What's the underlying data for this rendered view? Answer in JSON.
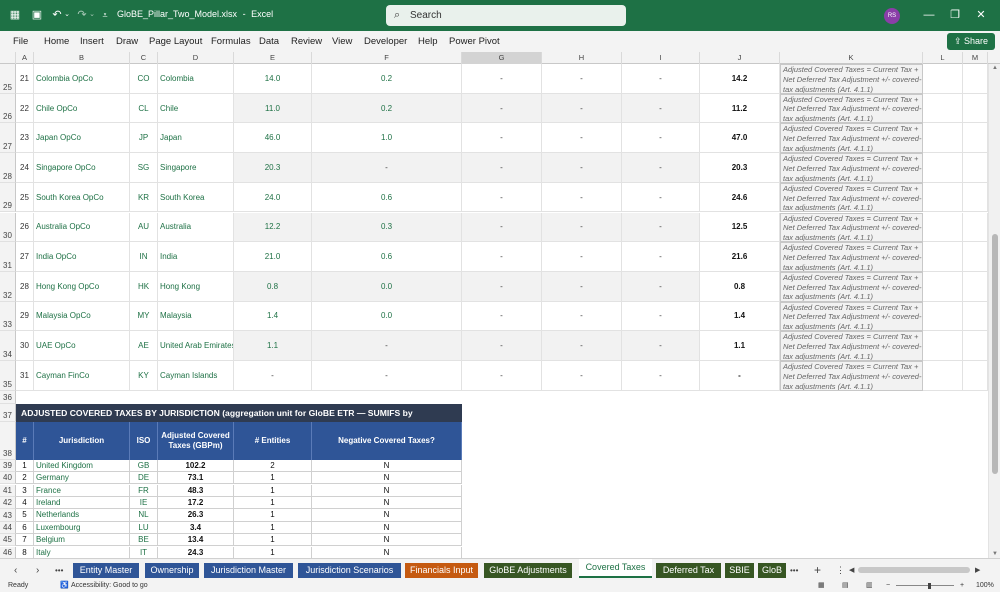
{
  "titlebar": {
    "filename": "GloBE_Pillar_Two_Model.xlsx",
    "separator": "-",
    "app": "Excel",
    "search_placeholder": "Search",
    "avatar_initials": "RS"
  },
  "menu": [
    "File",
    "Home",
    "Insert",
    "Draw",
    "Page Layout",
    "Formulas",
    "Data",
    "Review",
    "View",
    "Developer",
    "Help",
    "Power Pivot"
  ],
  "share_label": "Share",
  "columns": [
    "A",
    "B",
    "C",
    "D",
    "E",
    "F",
    "G",
    "H",
    "I",
    "J",
    "K",
    "L",
    "M"
  ],
  "entity_rows": [
    {
      "row": "25",
      "a": "21",
      "name": "Colombia OpCo",
      "iso": "CO",
      "country": "Colombia",
      "e": "14.0",
      "f": "0.2",
      "g": "-",
      "h": "-",
      "i": "-",
      "j": "14.2"
    },
    {
      "row": "26",
      "a": "22",
      "name": "Chile OpCo",
      "iso": "CL",
      "country": "Chile",
      "e": "11.0",
      "f": "0.2",
      "g": "-",
      "h": "-",
      "i": "-",
      "j": "11.2"
    },
    {
      "row": "27",
      "a": "23",
      "name": "Japan OpCo",
      "iso": "JP",
      "country": "Japan",
      "e": "46.0",
      "f": "1.0",
      "g": "-",
      "h": "-",
      "i": "-",
      "j": "47.0"
    },
    {
      "row": "28",
      "a": "24",
      "name": "Singapore OpCo",
      "iso": "SG",
      "country": "Singapore",
      "e": "20.3",
      "f": "-",
      "g": "-",
      "h": "-",
      "i": "-",
      "j": "20.3"
    },
    {
      "row": "29",
      "a": "25",
      "name": "South Korea OpCo",
      "iso": "KR",
      "country": "South Korea",
      "e": "24.0",
      "f": "0.6",
      "g": "-",
      "h": "-",
      "i": "-",
      "j": "24.6"
    },
    {
      "row": "30",
      "a": "26",
      "name": "Australia OpCo",
      "iso": "AU",
      "country": "Australia",
      "e": "12.2",
      "f": "0.3",
      "g": "-",
      "h": "-",
      "i": "-",
      "j": "12.5"
    },
    {
      "row": "31",
      "a": "27",
      "name": "India OpCo",
      "iso": "IN",
      "country": "India",
      "e": "21.0",
      "f": "0.6",
      "g": "-",
      "h": "-",
      "i": "-",
      "j": "21.6"
    },
    {
      "row": "32",
      "a": "28",
      "name": "Hong Kong OpCo",
      "iso": "HK",
      "country": "Hong Kong",
      "e": "0.8",
      "f": "0.0",
      "g": "-",
      "h": "-",
      "i": "-",
      "j": "0.8"
    },
    {
      "row": "33",
      "a": "29",
      "name": "Malaysia OpCo",
      "iso": "MY",
      "country": "Malaysia",
      "e": "1.4",
      "f": "0.0",
      "g": "-",
      "h": "-",
      "i": "-",
      "j": "1.4"
    },
    {
      "row": "34",
      "a": "30",
      "name": "UAE OpCo",
      "iso": "AE",
      "country": "United Arab Emirates",
      "e": "1.1",
      "f": "-",
      "g": "-",
      "h": "-",
      "i": "-",
      "j": "1.1"
    },
    {
      "row": "35",
      "a": "31",
      "name": "Cayman FinCo",
      "iso": "KY",
      "country": "Cayman Islands",
      "e": "-",
      "f": "-",
      "g": "-",
      "h": "-",
      "i": "-",
      "j": "-"
    }
  ],
  "note_text": "Adjusted Covered Taxes = Current Tax + Net Deferred Tax Adjustment +/- covered-tax adjustments (Art. 4.1.1)",
  "blank_row": "36",
  "summary": {
    "banner_row": "37",
    "banner": "ADJUSTED COVERED TAXES BY JURISDICTION  (aggregation unit for GloBE ETR — SUMIFS by",
    "header_row": "38",
    "headers": [
      "#",
      "Jurisdiction",
      "ISO",
      "Adjusted Covered Taxes (GBPm)",
      "# Entities",
      "Negative Covered Taxes?"
    ],
    "rows": [
      {
        "row": "39",
        "n": "1",
        "j": "United Kingdom",
        "iso": "GB",
        "tax": "102.2",
        "ent": "2",
        "neg": "N"
      },
      {
        "row": "40",
        "n": "2",
        "j": "Germany",
        "iso": "DE",
        "tax": "73.1",
        "ent": "1",
        "neg": "N"
      },
      {
        "row": "41",
        "n": "3",
        "j": "France",
        "iso": "FR",
        "tax": "48.3",
        "ent": "1",
        "neg": "N"
      },
      {
        "row": "42",
        "n": "4",
        "j": "Ireland",
        "iso": "IE",
        "tax": "17.2",
        "ent": "1",
        "neg": "N"
      },
      {
        "row": "43",
        "n": "5",
        "j": "Netherlands",
        "iso": "NL",
        "tax": "26.3",
        "ent": "1",
        "neg": "N"
      },
      {
        "row": "44",
        "n": "6",
        "j": "Luxembourg",
        "iso": "LU",
        "tax": "3.4",
        "ent": "1",
        "neg": "N"
      },
      {
        "row": "45",
        "n": "7",
        "j": "Belgium",
        "iso": "BE",
        "tax": "13.4",
        "ent": "1",
        "neg": "N"
      },
      {
        "row": "46",
        "n": "8",
        "j": "Italy",
        "iso": "IT",
        "tax": "24.3",
        "ent": "1",
        "neg": "N"
      }
    ]
  },
  "tabs": [
    {
      "label": "Entity Master",
      "color": "#2f5597"
    },
    {
      "label": "Ownership",
      "color": "#2f5597"
    },
    {
      "label": "Jurisdiction Master",
      "color": "#2f5597"
    },
    {
      "label": "Jurisdiction Scenarios",
      "color": "#2f5597"
    },
    {
      "label": "Financials Input",
      "color": "#c55a11"
    },
    {
      "label": "GloBE Adjustments",
      "color": "#375623"
    },
    {
      "label": "Covered Taxes",
      "color": "#ffffff",
      "active": true
    },
    {
      "label": "Deferred Tax",
      "color": "#375623"
    },
    {
      "label": "SBIE",
      "color": "#375623"
    },
    {
      "label": "GloB",
      "color": "#375623"
    }
  ],
  "status": {
    "ready": "Ready",
    "accessibility": "Accessibility: Good to go",
    "zoom": "100%"
  }
}
